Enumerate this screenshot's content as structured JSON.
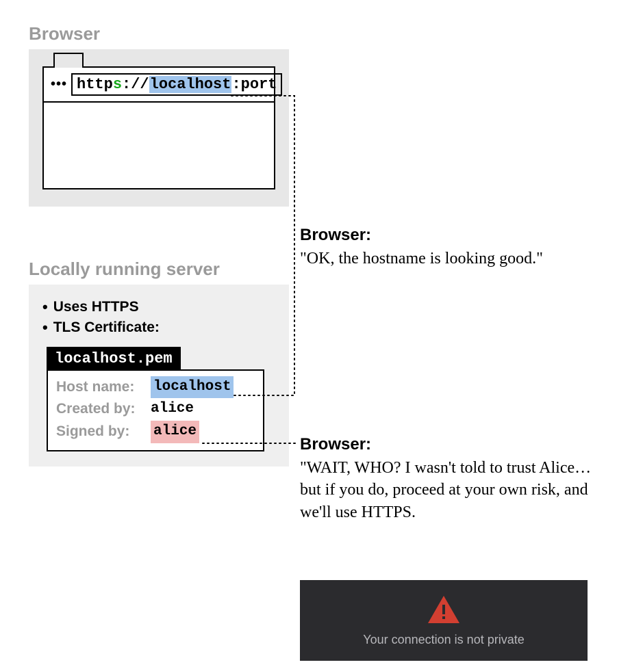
{
  "sections": {
    "browser_title": "Browser",
    "server_title": "Locally running server"
  },
  "browser": {
    "dots": "•••",
    "url_parts": {
      "http": "http",
      "s": "s",
      "sep": "://",
      "host": "localhost",
      "colon": ":",
      "port": "port"
    }
  },
  "server": {
    "bullets": [
      "Uses HTTPS",
      "TLS Certificate:"
    ],
    "pem_filename": "localhost.pem",
    "cert": {
      "hostname_label": "Host name:",
      "hostname_value": "localhost",
      "created_label": "Created by:",
      "created_value": "alice",
      "signed_label": "Signed by:",
      "signed_value": "alice"
    }
  },
  "annotations": {
    "a1_heading": "Browser:",
    "a1_text": "\"OK, the hostname is looking good.\"",
    "a2_heading": "Browser:",
    "a2_text": "\"WAIT, WHO? I wasn't told to trust Alice… but if you do, proceed at your own risk, and we'll use HTTPS."
  },
  "warning": {
    "text": "Your connection is not private"
  },
  "colors": {
    "highlight_blue": "#9fc4ec",
    "highlight_red": "#f3b9b9",
    "green": "#17a81a",
    "banner_bg": "#2b2b2e",
    "banner_text": "#b7b7bb",
    "triangle_red": "#d23f31"
  }
}
